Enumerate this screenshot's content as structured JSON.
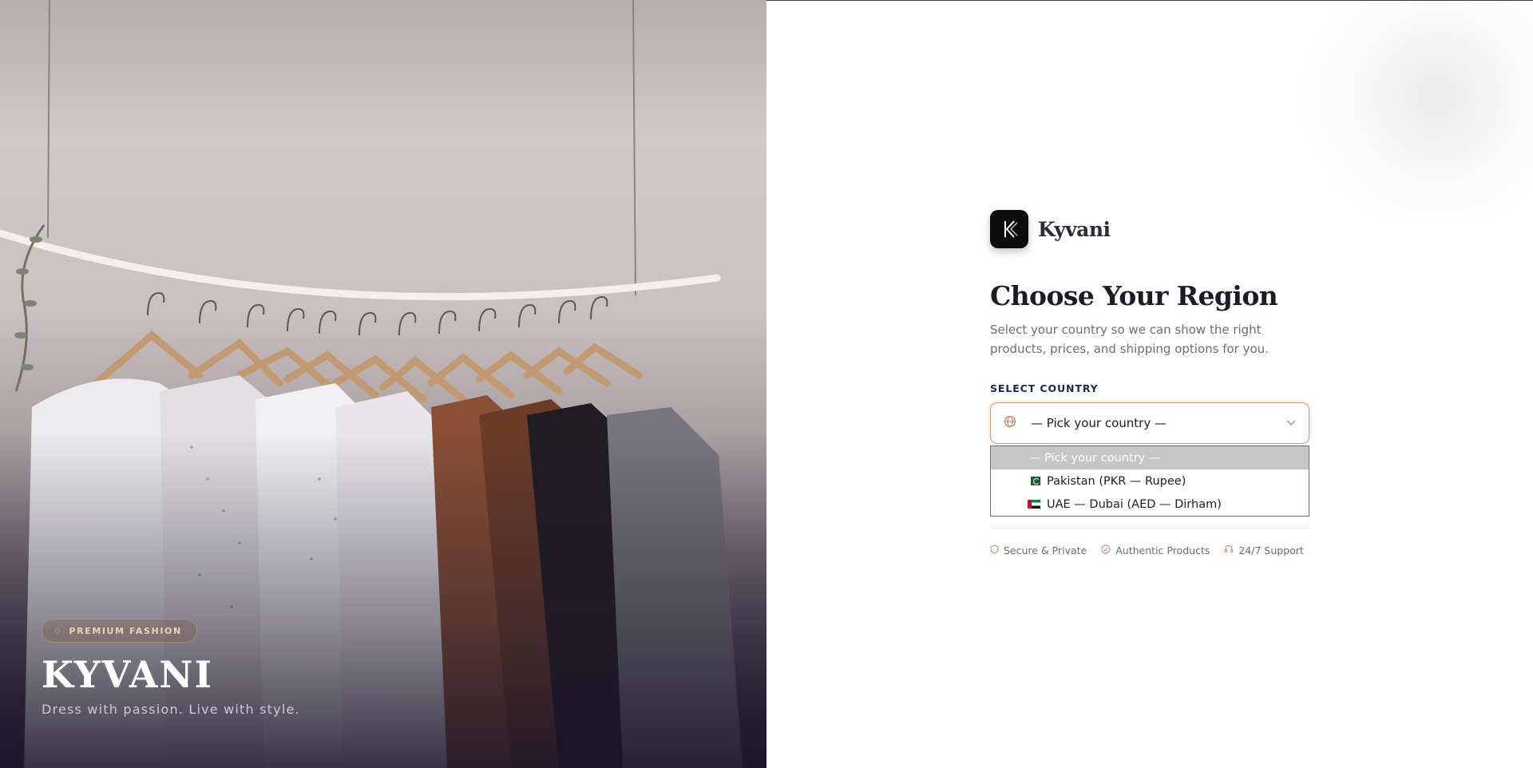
{
  "hero": {
    "badge_label": "PREMIUM FASHION",
    "badge_icon": "diamond-icon",
    "brand": "KYVANI",
    "tagline": "Dress with passion. Live with style."
  },
  "panel": {
    "logo_text": "Kyvani",
    "heading": "Choose Your Region",
    "subtext": "Select your country so we can show the right products, prices, and shipping options for you.",
    "select_label": "SELECT COUNTRY",
    "select_value": "— Pick your country —",
    "options": [
      {
        "label": "— Pick your country —",
        "selected": true
      },
      {
        "label": "Pakistan  (PKR — Rupee)",
        "flag": "flag-pakistan"
      },
      {
        "label": "UAE — Dubai  (AED — Dirham)",
        "flag": "flag-uae"
      }
    ],
    "trust": [
      {
        "icon": "shield-icon",
        "label": "Secure & Private"
      },
      {
        "icon": "check-circle-icon",
        "label": "Authentic Products"
      },
      {
        "icon": "headset-icon",
        "label": "24/7 Support"
      }
    ]
  },
  "colors": {
    "accent": "#c79b74",
    "heading": "#1c1c24",
    "muted": "#6c6c78",
    "label": "#1e2a44"
  }
}
